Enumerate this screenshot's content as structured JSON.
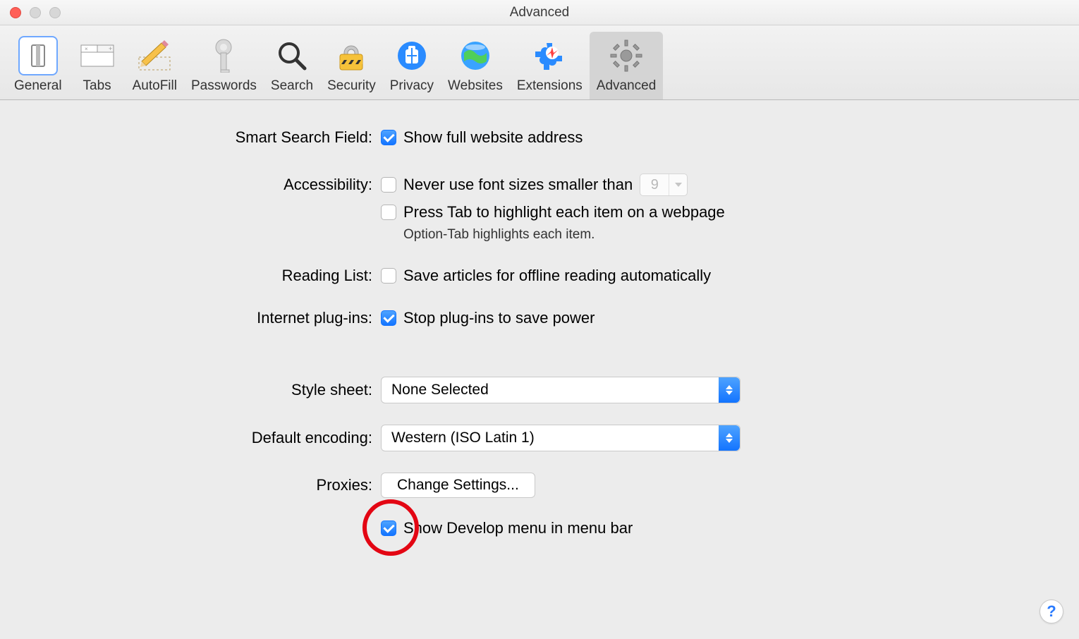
{
  "window": {
    "title": "Advanced"
  },
  "toolbar": {
    "items": [
      {
        "label": "General"
      },
      {
        "label": "Tabs"
      },
      {
        "label": "AutoFill"
      },
      {
        "label": "Passwords"
      },
      {
        "label": "Search"
      },
      {
        "label": "Security"
      },
      {
        "label": "Privacy"
      },
      {
        "label": "Websites"
      },
      {
        "label": "Extensions"
      },
      {
        "label": "Advanced"
      }
    ]
  },
  "sections": {
    "smart_search": {
      "label": "Smart Search Field:",
      "show_full_address": "Show full website address"
    },
    "accessibility": {
      "label": "Accessibility:",
      "never_font_smaller": "Never use font sizes smaller than",
      "font_min_value": "9",
      "press_tab": "Press Tab to highlight each item on a webpage",
      "option_tab_hint": "Option-Tab highlights each item."
    },
    "reading_list": {
      "label": "Reading List:",
      "save_offline": "Save articles for offline reading automatically"
    },
    "plugins": {
      "label": "Internet plug-ins:",
      "stop_plugins": "Stop plug-ins to save power"
    },
    "style_sheet": {
      "label": "Style sheet:",
      "value": "None Selected"
    },
    "default_encoding": {
      "label": "Default encoding:",
      "value": "Western (ISO Latin 1)"
    },
    "proxies": {
      "label": "Proxies:",
      "button": "Change Settings..."
    },
    "develop": {
      "label": "Show Develop menu in menu bar"
    }
  },
  "help_glyph": "?"
}
